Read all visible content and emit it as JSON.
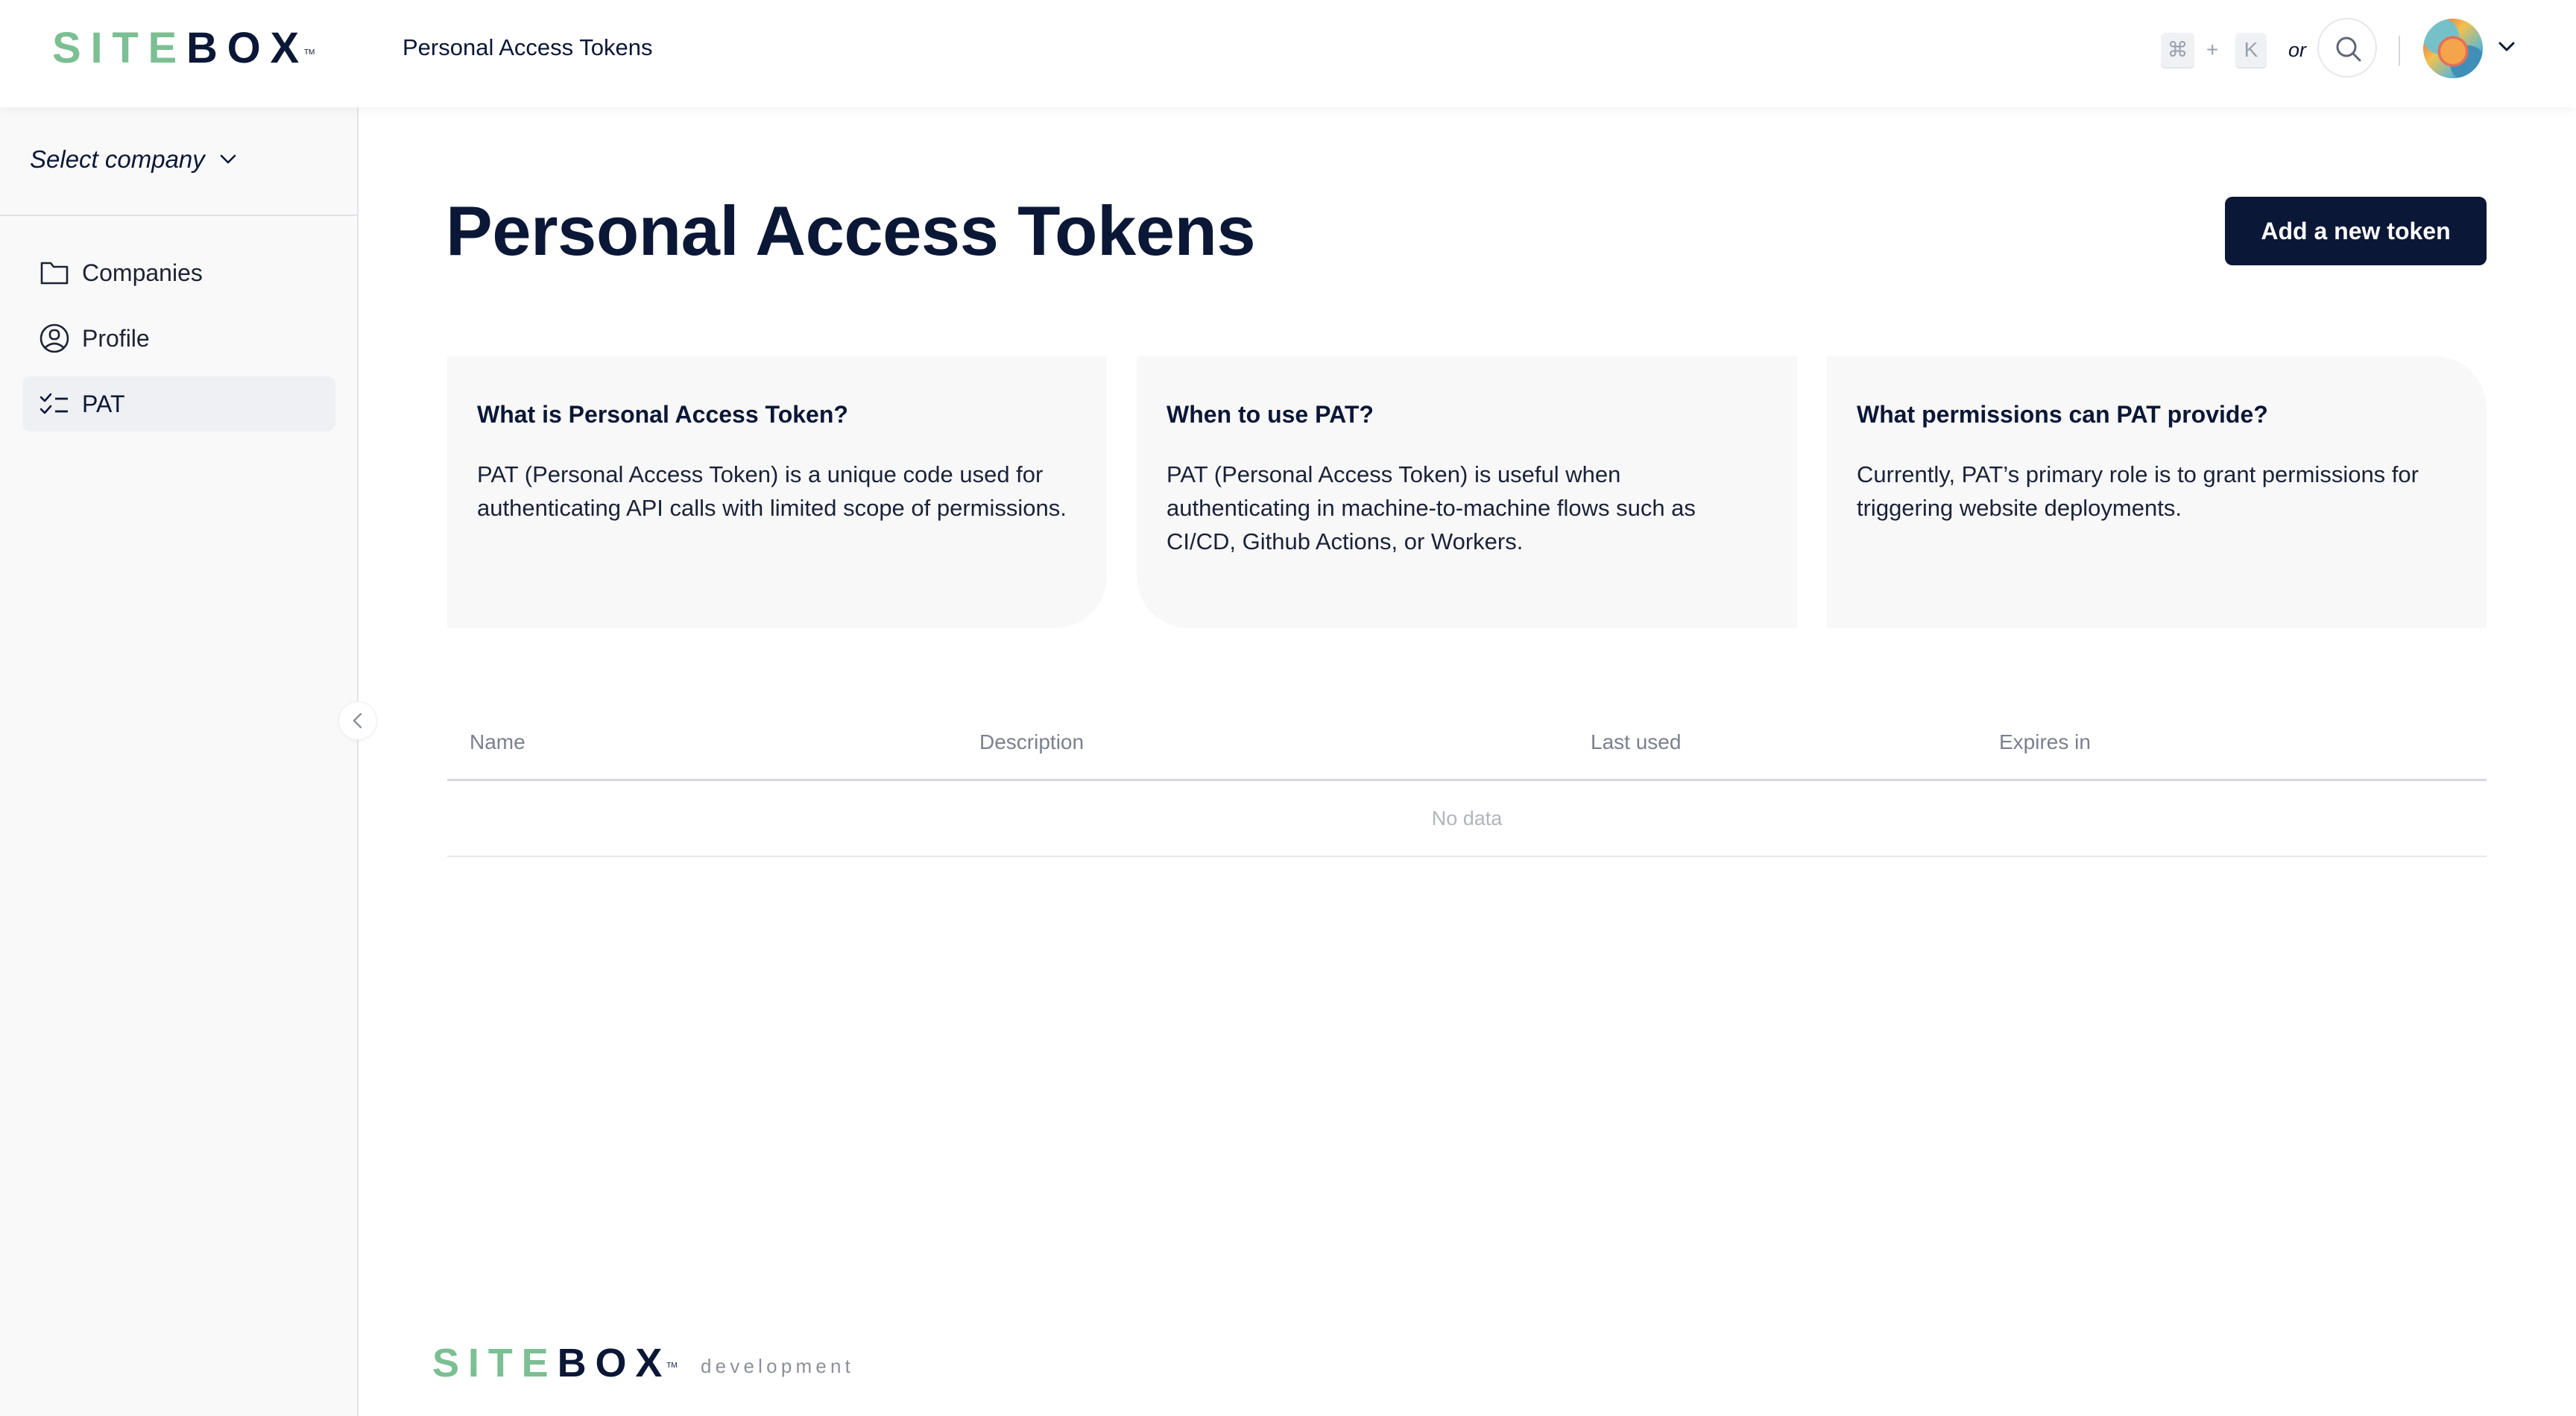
{
  "brand": {
    "logo_left": "SIT",
    "logo_mid": "E",
    "logo_right": "BOX",
    "trademark": "TM",
    "footer_subtitle": "development",
    "colors": {
      "green": "#7bbf93",
      "navy": "#0b1736"
    }
  },
  "header": {
    "title": "Personal Access Tokens",
    "shortcut": {
      "key1": "⌘",
      "plus": "+",
      "key2": "K",
      "or": "or"
    },
    "search_icon": "search-icon",
    "avatar_alt": "user avatar",
    "menu_icon": "chevron-down-icon"
  },
  "sidebar": {
    "company_select": "Select company",
    "items": [
      {
        "label": "Companies",
        "icon": "folder-icon",
        "active": false
      },
      {
        "label": "Profile",
        "icon": "user-circle-icon",
        "active": false
      },
      {
        "label": "PAT",
        "icon": "checklist-icon",
        "active": true
      }
    ],
    "collapse_icon": "chevron-left-icon"
  },
  "main": {
    "page_title": "Personal Access Tokens",
    "add_button": "Add a new token",
    "cards": [
      {
        "title": "What is Personal Access Token?",
        "body": "PAT (Personal Access Token) is a unique code used for authenticating API calls with limited scope of permissions."
      },
      {
        "title": "When to use PAT?",
        "body": "PAT (Personal Access Token) is useful when authenticating in machine-to-machine flows such as CI/CD, Github Actions, or Workers."
      },
      {
        "title": "What permissions can PAT provide?",
        "body": "Currently, PAT’s primary role is to grant permissions for triggering website deployments."
      }
    ],
    "table": {
      "columns": [
        "Name",
        "Description",
        "Last used",
        "Expires in"
      ],
      "rows": [],
      "empty_text": "No data"
    }
  }
}
